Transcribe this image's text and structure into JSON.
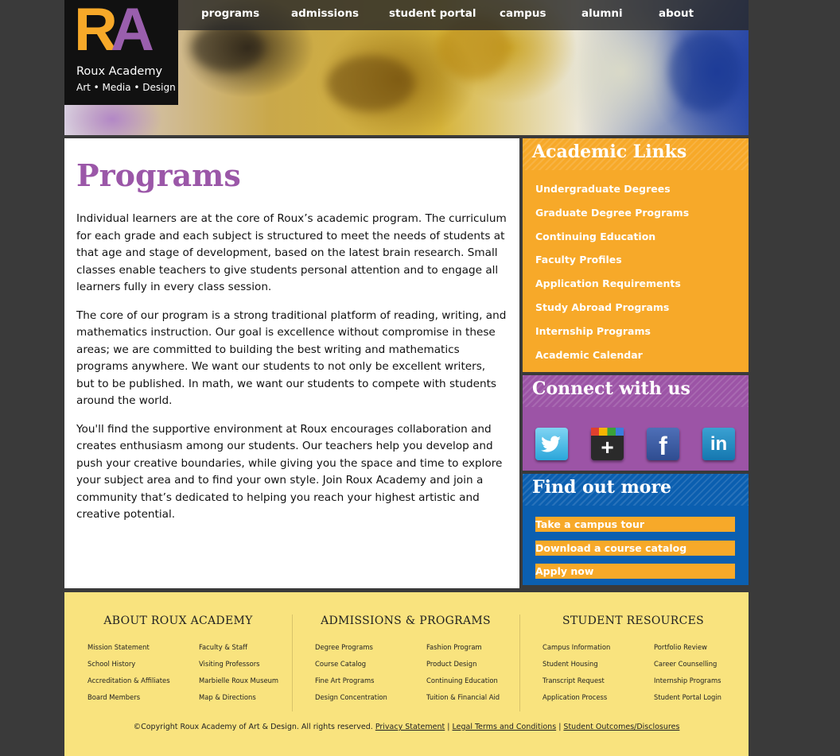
{
  "logo": {
    "letter_r": "R",
    "letter_a": "A",
    "name": "Roux Academy",
    "tagline": "Art • Media • Design"
  },
  "nav": [
    "programs",
    "admissions",
    "student portal",
    "campus",
    "alumni",
    "about"
  ],
  "main": {
    "title": "Programs",
    "paragraphs": [
      "Individual learners are at the core of Roux’s academic program. The curriculum for each grade and each subject is structured to meet the needs of students at that age and stage of development, based on the latest brain research. Small classes enable teachers to give students personal attention and to engage all learners fully in every class session.",
      "The core of our program is a strong traditional platform of reading, writing, and mathematics instruction. Our goal is excellence without compromise in these areas; we are committed to building the best writing and mathematics programs anywhere. We want our students to not only be excellent writers, but to be published. In math, we want our students to compete with students around the world.",
      "You'll find the supportive environment at Roux encourages collaboration and creates enthusiasm among our students. Our teachers help you develop and push your creative boundaries, while giving you the space and time to explore your subject area and to find your own style. Join Roux Academy and join a community that’s dedicated to helping you reach your highest artistic and creative potential."
    ]
  },
  "sidebar": {
    "academic_links": {
      "title": "Academic Links",
      "items": [
        "Undergraduate Degrees",
        "Graduate Degree Programs",
        "Continuing Education",
        "Faculty Profiles",
        "Application Requirements",
        "Study Abroad Programs",
        "Internship Programs",
        "Academic Calendar"
      ]
    },
    "connect": {
      "title": "Connect with us",
      "icons": [
        "twitter-icon",
        "google-plus-icon",
        "facebook-icon",
        "linkedin-icon"
      ],
      "glyphs": {
        "google_plus": "+",
        "facebook": "f",
        "linkedin": "in"
      }
    },
    "find_more": {
      "title": "Find out more",
      "items": [
        "Take a campus tour",
        "Download a course catalog",
        "Apply now"
      ]
    }
  },
  "footer": {
    "columns": [
      {
        "title": "ABOUT ROUX ACADEMY",
        "links": [
          "Mission Statement",
          "Faculty & Staff",
          "School History",
          "Visiting Professors",
          "Accreditation & Affiliates",
          "Marbielle Roux Museum",
          "Board Members",
          "Map & Directions"
        ]
      },
      {
        "title": "ADMISSIONS & PROGRAMS",
        "links": [
          "Degree Programs",
          "Fashion Program",
          "Course Catalog",
          "Product Design",
          "Fine Art Programs",
          "Continuing Education",
          "Design Concentration",
          "Tuition & Financial Aid"
        ]
      },
      {
        "title": "STUDENT RESOURCES",
        "links": [
          "Campus Information",
          "Portfolio Review",
          "Student Housing",
          "Career Counselling",
          "Transcript Request",
          "Internship Programs",
          "Application Process",
          "Student Portal Login"
        ]
      }
    ],
    "copyright": "©Copyright Roux Academy of Art & Design. All rights reserved.",
    "separator": "|",
    "legal_links": [
      " Privacy Statement",
      " Legal Terms and Conditions",
      " Student Outcomes/Disclosures"
    ]
  },
  "colors": {
    "purple": "#9b57a8",
    "orange": "#f7a929",
    "blue": "#0b5fb0",
    "footer_yellow": "#f9e37e"
  }
}
